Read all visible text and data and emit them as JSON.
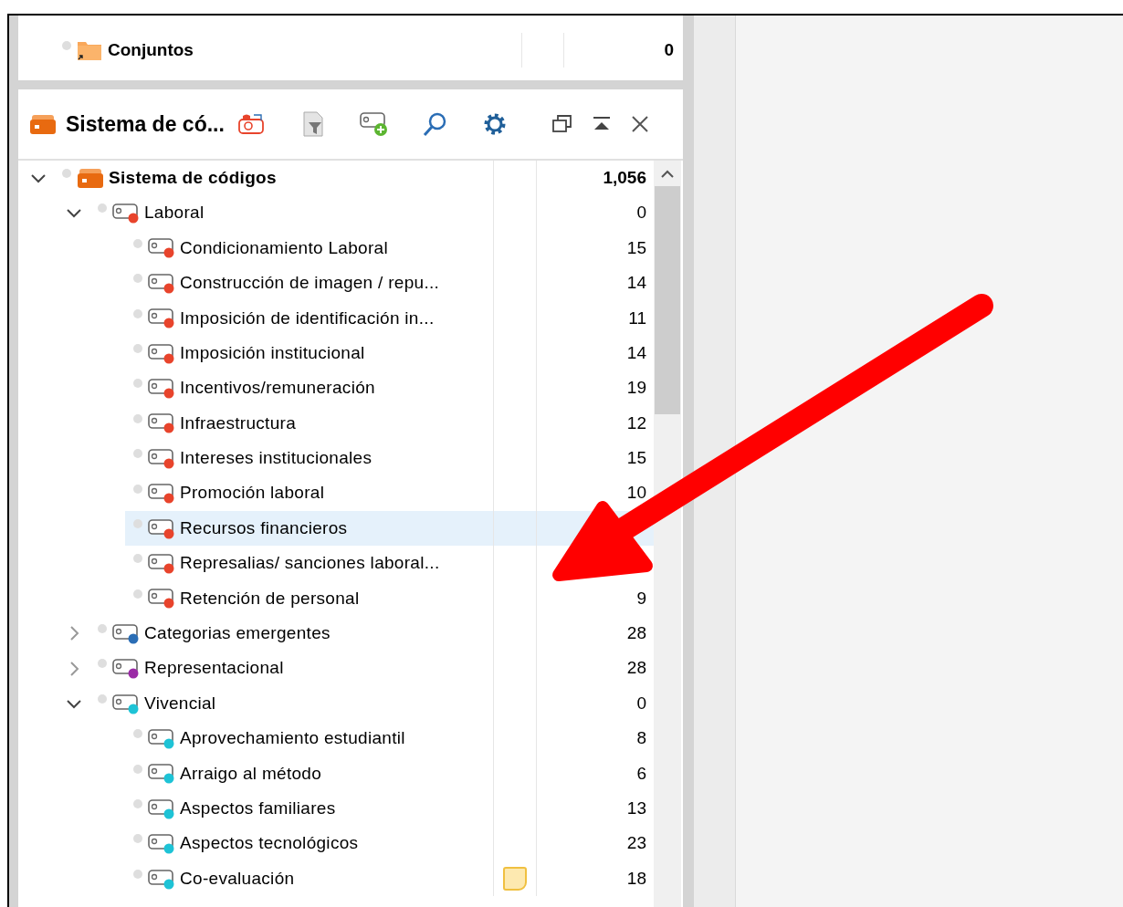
{
  "sets_panel": {
    "rows": [
      {
        "kind": "set",
        "label": "Conjuntos",
        "count": "0"
      }
    ]
  },
  "code_system_panel": {
    "title": "Sistema de có...",
    "tree": [
      {
        "kind": "root",
        "label": "Sistema de códigos",
        "count": "1,056",
        "expanded": true,
        "selected": false,
        "memo": false,
        "children": [
          {
            "kind": "code",
            "label": "Laboral",
            "count": "0",
            "color": "#e8442c",
            "expanded": true,
            "selected": false,
            "memo": false,
            "children": [
              {
                "kind": "code",
                "label": "Condicionamiento Laboral",
                "count": "15",
                "color": "#e8442c",
                "selected": false,
                "memo": false
              },
              {
                "kind": "code",
                "label": "Construcción de imagen / repu...",
                "count": "14",
                "color": "#e8442c",
                "selected": false,
                "memo": false
              },
              {
                "kind": "code",
                "label": "Imposición de identificación in...",
                "count": "11",
                "color": "#e8442c",
                "selected": false,
                "memo": false
              },
              {
                "kind": "code",
                "label": "Imposición institucional",
                "count": "14",
                "color": "#e8442c",
                "selected": false,
                "memo": false
              },
              {
                "kind": "code",
                "label": "Incentivos/remuneración",
                "count": "19",
                "color": "#e8442c",
                "selected": false,
                "memo": false
              },
              {
                "kind": "code",
                "label": "Infraestructura",
                "count": "12",
                "color": "#e8442c",
                "selected": false,
                "memo": false
              },
              {
                "kind": "code",
                "label": "Intereses institucionales",
                "count": "15",
                "color": "#e8442c",
                "selected": false,
                "memo": false
              },
              {
                "kind": "code",
                "label": "Promoción laboral",
                "count": "10",
                "color": "#e8442c",
                "selected": false,
                "memo": false
              },
              {
                "kind": "code",
                "label": "Recursos financieros",
                "color": "#e8442c",
                "selected": true,
                "memo": false
              },
              {
                "kind": "code",
                "label": "Represalias/ sanciones  laboral...",
                "color": "#e8442c",
                "selected": false,
                "memo": false
              },
              {
                "kind": "code",
                "label": "Retención de personal",
                "count": "9",
                "color": "#e8442c",
                "selected": false,
                "memo": false
              }
            ]
          },
          {
            "kind": "code",
            "label": "Categorias emergentes",
            "count": "28",
            "color": "#2a6db5",
            "expanded": false,
            "selected": false,
            "memo": false
          },
          {
            "kind": "code",
            "label": "Representacional",
            "count": "28",
            "color": "#9b2aa6",
            "expanded": false,
            "selected": false,
            "memo": false
          },
          {
            "kind": "code",
            "label": "Vivencial",
            "count": "0",
            "color": "#1ec3d6",
            "expanded": true,
            "selected": false,
            "memo": false,
            "children": [
              {
                "kind": "code",
                "label": "Aprovechamiento estudiantil",
                "count": "8",
                "color": "#1ec3d6",
                "selected": false,
                "memo": false
              },
              {
                "kind": "code",
                "label": "Arraigo al método",
                "count": "6",
                "color": "#1ec3d6",
                "selected": false,
                "memo": false
              },
              {
                "kind": "code",
                "label": "Aspectos familiares",
                "count": "13",
                "color": "#1ec3d6",
                "selected": false,
                "memo": false
              },
              {
                "kind": "code",
                "label": "Aspectos tecnológicos",
                "count": "23",
                "color": "#1ec3d6",
                "selected": false,
                "memo": false
              },
              {
                "kind": "code",
                "label": "Co-evaluación",
                "count": "18",
                "color": "#1ec3d6",
                "selected": false,
                "memo": true
              }
            ]
          }
        ]
      }
    ]
  }
}
